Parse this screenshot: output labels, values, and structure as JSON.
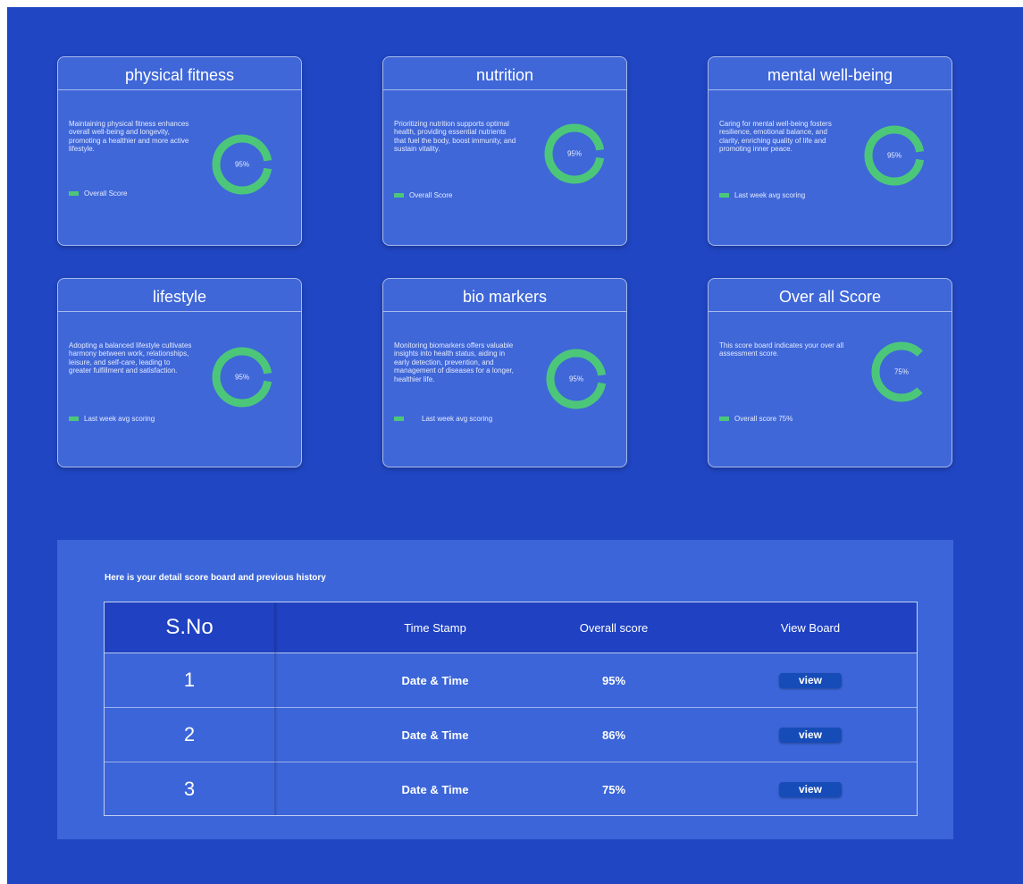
{
  "colors": {
    "background": "#2046c3",
    "card": "#3f67d8",
    "accent": "#4cc77a",
    "button": "#164cb7"
  },
  "cards": [
    {
      "title": "physical fitness",
      "description": "Maintaining physical fitness enhances overall well-being and longevity, promoting a healthier and more active lifestyle.",
      "score_label": "95%",
      "score": 0.95,
      "legend": "Overall Score"
    },
    {
      "title": "nutrition",
      "description": "Prioritizing nutrition supports optimal health, providing essential nutrients that fuel the body, boost immunity, and sustain vitality.",
      "score_label": "95%",
      "score": 0.95,
      "legend": "Overall Score"
    },
    {
      "title": "mental well-being",
      "description": "Caring for mental well-being fosters resilience, emotional balance, and clarity, enriching quality of life and promoting inner peace.",
      "score_label": "95%",
      "score": 0.95,
      "legend": "Last week avg scoring"
    },
    {
      "title": "lifestyle",
      "description": "Adopting a balanced lifestyle cultivates harmony between work, relationships, leisure, and self-care, leading to greater fulfillment and satisfaction.",
      "score_label": "95%",
      "score": 0.95,
      "legend": "Last week avg scoring"
    },
    {
      "title": "bio markers",
      "description": "Monitoring biomarkers offers valuable insights into health status, aiding in early detection, prevention, and management of diseases for a longer, healthier life.",
      "score_label": "95%",
      "score": 0.95,
      "legend": "Last week avg scoring"
    },
    {
      "title": "Over all Score",
      "description": "This score board indicates your over all assessment score.",
      "score_label": "75%",
      "score": 0.75,
      "legend": "Overall score  75%"
    }
  ],
  "scoreboard": {
    "caption": "Here is your detail score board and previous history",
    "headers": {
      "sno": "S.No",
      "time": "Time Stamp",
      "score": "Overall score",
      "view": "View Board"
    },
    "rows": [
      {
        "sno": "1",
        "time": "Date & Time",
        "score": "95%",
        "action": "view"
      },
      {
        "sno": "2",
        "time": "Date & Time",
        "score": "86%",
        "action": "view"
      },
      {
        "sno": "3",
        "time": "Date & Time",
        "score": "75%",
        "action": "view"
      }
    ]
  }
}
